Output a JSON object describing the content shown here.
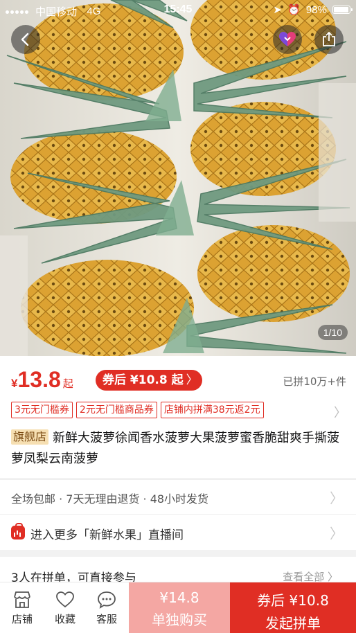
{
  "status_bar": {
    "carrier": "中国移动",
    "network": "4G",
    "time": "15:45",
    "battery": "98%"
  },
  "gallery": {
    "pager": "1/10",
    "icons": [
      "back-arrow-icon",
      "heart-icon",
      "share-icon"
    ]
  },
  "price": {
    "currency": "¥",
    "amount": "13.8",
    "suffix": "起",
    "coupon_label": "券后 ¥10.8 起",
    "group_count": "已拼10万+件"
  },
  "coupons": [
    "3元无门槛券",
    "2元无门槛商品券",
    "店铺内拼满38元返2元"
  ],
  "product": {
    "badge": "旗舰店",
    "title": "新鲜大菠萝徐闻香水菠萝大果菠萝蜜香脆甜爽手撕菠萝凤梨云南菠萝"
  },
  "service": {
    "text": "全场包邮 · 7天无理由退货 · 48小时发货"
  },
  "live": {
    "text": "进入更多「新鲜水果」直播间"
  },
  "group_section": {
    "text": "3人在拼单，可直接参与",
    "view_all": "查看全部"
  },
  "bottom_bar": {
    "shop": "店铺",
    "favorite": "收藏",
    "service": "客服",
    "solo_price": "¥14.8",
    "solo_label": "单独购买",
    "group_price": "券后 ¥10.8",
    "group_label": "发起拼单"
  },
  "colors": {
    "accent": "#e02e24",
    "accent_light": "#f4a7a3",
    "badge_bg": "#f6dfb2"
  }
}
